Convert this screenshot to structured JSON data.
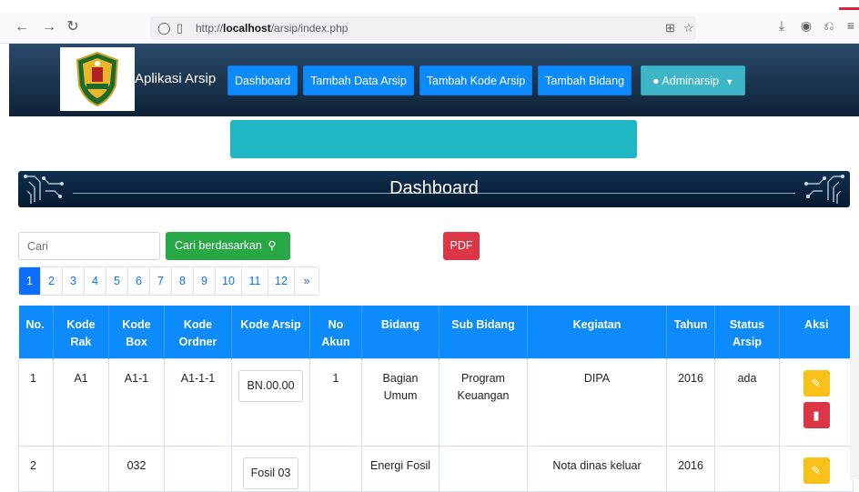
{
  "browser": {
    "url_prefix": "http://",
    "url_host": "localhost",
    "url_path": "/arsip/index.php"
  },
  "navbar": {
    "brand": "Aplikasi Arsip",
    "items": [
      {
        "label": "Dashboard"
      },
      {
        "label": "Tambah Data Arsip"
      },
      {
        "label": "Tambah Kode Arsip"
      },
      {
        "label": "Tambah Bidang"
      }
    ],
    "user": "Adminarsip"
  },
  "banner": {
    "title": "Dashboard"
  },
  "search": {
    "placeholder": "Cari",
    "filter_label": "Cari berdasarkan",
    "pdf_label": "PDF"
  },
  "pagination": [
    "1",
    "2",
    "3",
    "4",
    "5",
    "6",
    "7",
    "8",
    "9",
    "10",
    "11",
    "12",
    "»"
  ],
  "table": {
    "headers": [
      "No.",
      "Kode Rak",
      "Kode Box",
      "Kode Ordner",
      "Kode Arsip",
      "No Akun",
      "Bidang",
      "Sub Bidang",
      "Kegiatan",
      "Tahun",
      "Status Arsip",
      "Aksi"
    ],
    "rows": [
      {
        "no": "1",
        "rak": "A1",
        "box": "A1-1",
        "ordner": "A1-1-1",
        "kode_arsip": "BN.00.00",
        "akun": "1",
        "bidang": "Bagian Umum",
        "sub_bidang": "Program Keuangan",
        "kegiatan": "DIPA",
        "tahun": "2016",
        "status": "ada"
      },
      {
        "no": "2",
        "rak": "",
        "box": "032",
        "ordner": "",
        "kode_arsip": "Fosil 03",
        "akun": "",
        "bidang": "Energi Fosil",
        "sub_bidang": "",
        "kegiatan": "Nota dinas keluar",
        "tahun": "2016",
        "status": ""
      }
    ]
  },
  "colors": {
    "primary": "#0d8bfd",
    "success": "#28a745",
    "danger": "#dc3545",
    "warning": "#f9c01a",
    "info": "#1fb7c4"
  }
}
